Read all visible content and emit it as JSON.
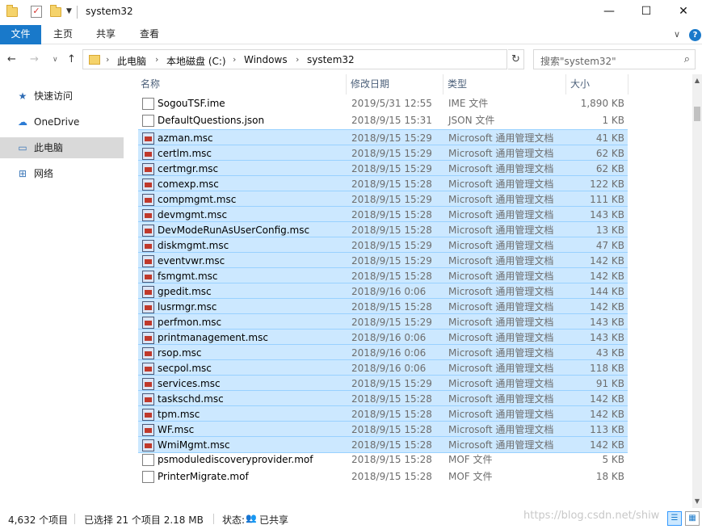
{
  "window": {
    "title": "system32",
    "minimize_glyph": "—",
    "maximize_glyph": "☐",
    "close_glyph": "✕"
  },
  "ribbon": {
    "tabs": [
      "文件",
      "主页",
      "共享",
      "查看"
    ]
  },
  "address": {
    "crumbs": [
      "此电脑",
      "本地磁盘 (C:)",
      "Windows",
      "system32"
    ],
    "search_placeholder": "搜索\"system32\""
  },
  "nav": {
    "items": [
      {
        "label": "快速访问",
        "icon": "star-icon",
        "selected": false
      },
      {
        "label": "OneDrive",
        "icon": "cloud-icon",
        "selected": false
      },
      {
        "label": "此电脑",
        "icon": "computer-icon",
        "selected": true
      },
      {
        "label": "网络",
        "icon": "network-icon",
        "selected": false
      }
    ]
  },
  "columns": {
    "name": "名称",
    "date": "修改日期",
    "type": "类型",
    "size": "大小"
  },
  "files": [
    {
      "name": "SogouTSF.ime",
      "date": "2019/5/31 12:55",
      "type": "IME 文件",
      "size": "1,890 KB",
      "selected": false,
      "icon": "doc"
    },
    {
      "name": "DefaultQuestions.json",
      "date": "2018/9/15 15:31",
      "type": "JSON 文件",
      "size": "1 KB",
      "selected": false,
      "icon": "doc"
    },
    {
      "name": "azman.msc",
      "date": "2018/9/15 15:29",
      "type": "Microsoft 通用管理文档",
      "size": "41 KB",
      "selected": true,
      "icon": "msc"
    },
    {
      "name": "certlm.msc",
      "date": "2018/9/15 15:29",
      "type": "Microsoft 通用管理文档",
      "size": "62 KB",
      "selected": true,
      "icon": "msc"
    },
    {
      "name": "certmgr.msc",
      "date": "2018/9/15 15:29",
      "type": "Microsoft 通用管理文档",
      "size": "62 KB",
      "selected": true,
      "icon": "msc"
    },
    {
      "name": "comexp.msc",
      "date": "2018/9/15 15:28",
      "type": "Microsoft 通用管理文档",
      "size": "122 KB",
      "selected": true,
      "icon": "msc"
    },
    {
      "name": "compmgmt.msc",
      "date": "2018/9/15 15:29",
      "type": "Microsoft 通用管理文档",
      "size": "111 KB",
      "selected": true,
      "icon": "msc"
    },
    {
      "name": "devmgmt.msc",
      "date": "2018/9/15 15:28",
      "type": "Microsoft 通用管理文档",
      "size": "143 KB",
      "selected": true,
      "icon": "msc"
    },
    {
      "name": "DevModeRunAsUserConfig.msc",
      "date": "2018/9/15 15:28",
      "type": "Microsoft 通用管理文档",
      "size": "13 KB",
      "selected": true,
      "icon": "msc"
    },
    {
      "name": "diskmgmt.msc",
      "date": "2018/9/15 15:29",
      "type": "Microsoft 通用管理文档",
      "size": "47 KB",
      "selected": true,
      "icon": "msc"
    },
    {
      "name": "eventvwr.msc",
      "date": "2018/9/15 15:29",
      "type": "Microsoft 通用管理文档",
      "size": "142 KB",
      "selected": true,
      "icon": "msc"
    },
    {
      "name": "fsmgmt.msc",
      "date": "2018/9/15 15:28",
      "type": "Microsoft 通用管理文档",
      "size": "142 KB",
      "selected": true,
      "icon": "msc"
    },
    {
      "name": "gpedit.msc",
      "date": "2018/9/16 0:06",
      "type": "Microsoft 通用管理文档",
      "size": "144 KB",
      "selected": true,
      "icon": "msc"
    },
    {
      "name": "lusrmgr.msc",
      "date": "2018/9/15 15:28",
      "type": "Microsoft 通用管理文档",
      "size": "142 KB",
      "selected": true,
      "icon": "msc"
    },
    {
      "name": "perfmon.msc",
      "date": "2018/9/15 15:29",
      "type": "Microsoft 通用管理文档",
      "size": "143 KB",
      "selected": true,
      "icon": "msc"
    },
    {
      "name": "printmanagement.msc",
      "date": "2018/9/16 0:06",
      "type": "Microsoft 通用管理文档",
      "size": "143 KB",
      "selected": true,
      "icon": "msc"
    },
    {
      "name": "rsop.msc",
      "date": "2018/9/16 0:06",
      "type": "Microsoft 通用管理文档",
      "size": "43 KB",
      "selected": true,
      "icon": "msc"
    },
    {
      "name": "secpol.msc",
      "date": "2018/9/16 0:06",
      "type": "Microsoft 通用管理文档",
      "size": "118 KB",
      "selected": true,
      "icon": "msc"
    },
    {
      "name": "services.msc",
      "date": "2018/9/15 15:29",
      "type": "Microsoft 通用管理文档",
      "size": "91 KB",
      "selected": true,
      "icon": "msc"
    },
    {
      "name": "taskschd.msc",
      "date": "2018/9/15 15:28",
      "type": "Microsoft 通用管理文档",
      "size": "142 KB",
      "selected": true,
      "icon": "msc"
    },
    {
      "name": "tpm.msc",
      "date": "2018/9/15 15:28",
      "type": "Microsoft 通用管理文档",
      "size": "142 KB",
      "selected": true,
      "icon": "msc"
    },
    {
      "name": "WF.msc",
      "date": "2018/9/15 15:28",
      "type": "Microsoft 通用管理文档",
      "size": "113 KB",
      "selected": true,
      "icon": "msc"
    },
    {
      "name": "WmiMgmt.msc",
      "date": "2018/9/15 15:28",
      "type": "Microsoft 通用管理文档",
      "size": "142 KB",
      "selected": true,
      "icon": "msc"
    },
    {
      "name": "psmodulediscoveryprovider.mof",
      "date": "2018/9/15 15:28",
      "type": "MOF 文件",
      "size": "5 KB",
      "selected": false,
      "icon": "doc"
    },
    {
      "name": "PrinterMigrate.mof",
      "date": "2018/9/15 15:28",
      "type": "MOF 文件",
      "size": "18 KB",
      "selected": false,
      "icon": "doc"
    }
  ],
  "status": {
    "item_count": "4,632 个项目",
    "selection": "已选择 21 个项目  2.18 MB",
    "state_label": "状态:",
    "share_state": "已共享",
    "watermark": "https://blog.csdn.net/shiw"
  },
  "colors": {
    "accent": "#1979ca",
    "selection_bg": "#cce8ff",
    "selection_border": "#99d1ff"
  }
}
